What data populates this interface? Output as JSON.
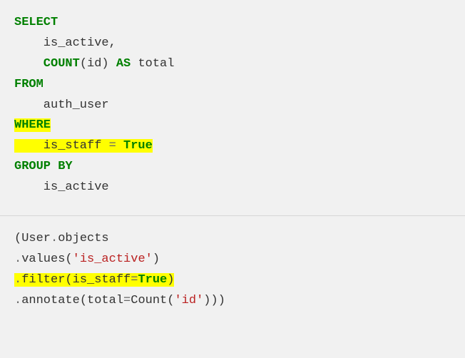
{
  "sql": {
    "select": "SELECT",
    "col1": "is_active,",
    "count_fn": "COUNT",
    "count_open": "(",
    "count_arg": "id",
    "count_close": ")",
    "as": "AS",
    "alias": "total",
    "from": "FROM",
    "table": "auth_user",
    "where": "WHERE",
    "where_col": "is_staff",
    "eq": "=",
    "true": "True",
    "groupby": "GROUP BY",
    "group_col": "is_active"
  },
  "py": {
    "open": "(",
    "user": "User",
    "dot1": ".",
    "objects": "objects",
    "values_dot": ".",
    "values": "values",
    "values_open": "(",
    "values_arg": "'is_active'",
    "values_close": ")",
    "filter_dot": ".",
    "filter": "filter",
    "filter_open": "(",
    "filter_kw": "is_staff",
    "filter_eq": "=",
    "filter_val": "True",
    "filter_close": ")",
    "annotate_dot": ".",
    "annotate": "annotate",
    "annotate_open": "(",
    "annotate_kw": "total",
    "annotate_eq": "=",
    "count_cls": "Count",
    "count_open": "(",
    "count_arg": "'id'",
    "count_close": ")",
    "annotate_close": ")",
    "close": ")"
  }
}
